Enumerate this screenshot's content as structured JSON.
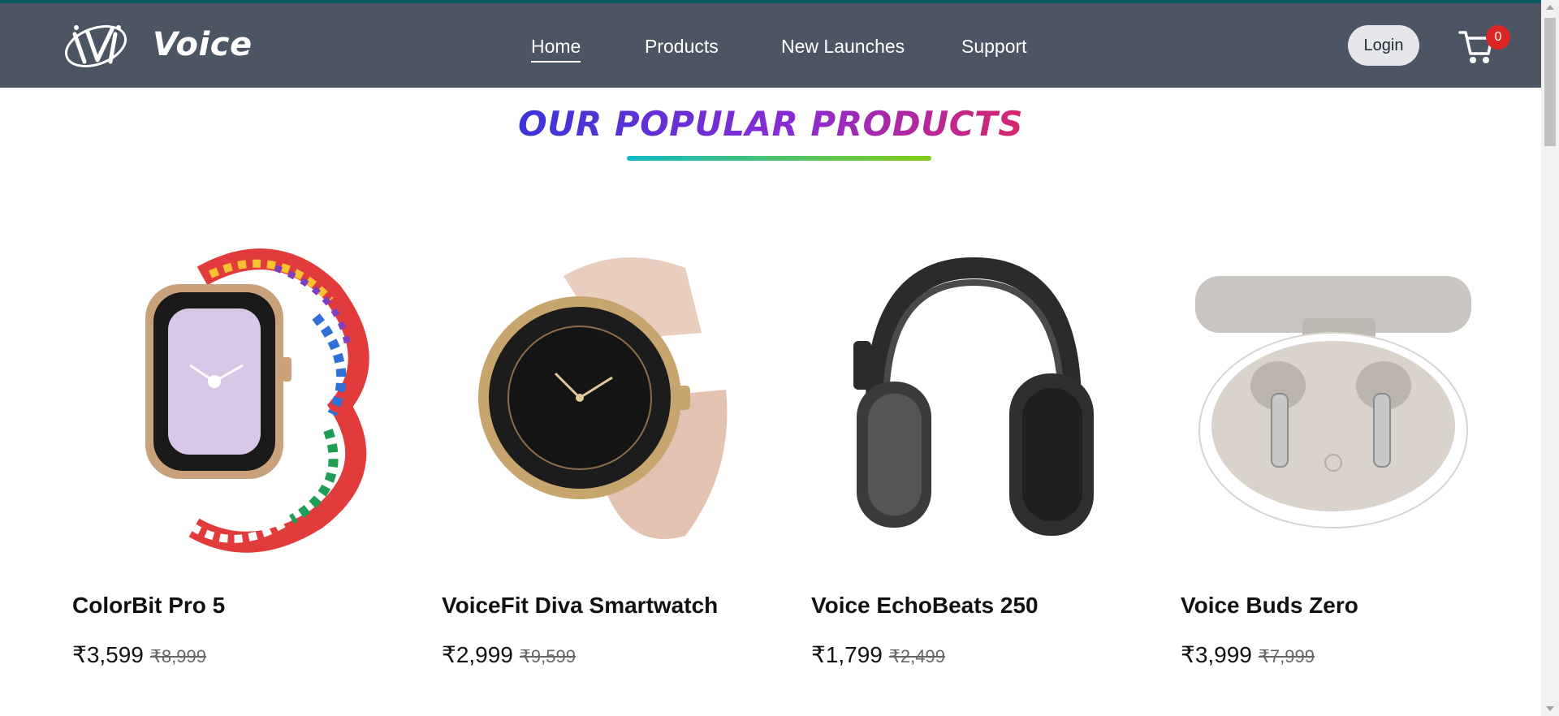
{
  "header": {
    "brand": "Voice",
    "nav": [
      {
        "label": "Home",
        "active": true
      },
      {
        "label": "Products",
        "active": false
      },
      {
        "label": "New Launches",
        "active": false
      },
      {
        "label": "Support",
        "active": false
      }
    ],
    "login_label": "Login",
    "cart_count": "0",
    "icons": [
      "voice-logo-icon",
      "cart-icon"
    ]
  },
  "section": {
    "title": "OUR POPULAR PRODUCTS"
  },
  "products": [
    {
      "name": "ColorBit Pro 5",
      "price": "₹3,599",
      "old_price": "₹8,999",
      "image": "smartwatch-braided-strap"
    },
    {
      "name": "VoiceFit Diva Smartwatch",
      "price": "₹2,999",
      "old_price": "₹9,599",
      "image": "round-smartwatch-pink-strap"
    },
    {
      "name": "Voice EchoBeats 250",
      "price": "₹1,799",
      "old_price": "₹2,499",
      "image": "over-ear-headphones"
    },
    {
      "name": "Voice Buds Zero",
      "price": "₹3,999",
      "old_price": "₹7,999",
      "image": "earbuds-case"
    }
  ],
  "colors": {
    "navbar": "#4b5563",
    "accent_line": "#0d5c63",
    "badge": "#dc2626",
    "title_gradient": [
      "#3b35d6",
      "#8b2bd4",
      "#d6266c"
    ],
    "underline_gradient": [
      "#14b8c6",
      "#84cc16"
    ]
  }
}
